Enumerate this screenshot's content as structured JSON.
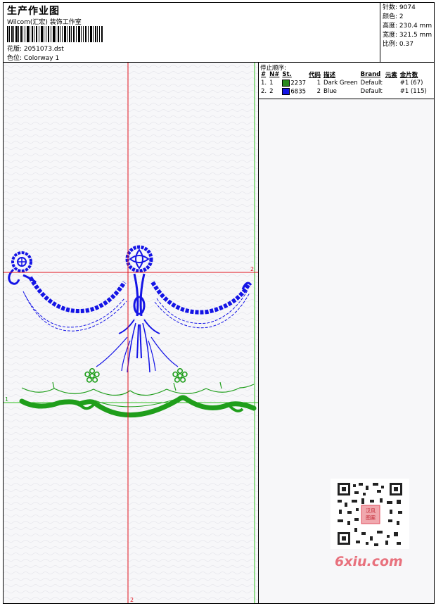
{
  "header": {
    "title": "生产作业图",
    "company": "Wilcom(汇宏) 装饰工作室",
    "design_label": "花版:",
    "design_value": "2051073.dst",
    "colorway_label": "色位:",
    "colorway_value": "Colorway 1"
  },
  "stats": {
    "stitches_label": "针数:",
    "stitches_value": "9074",
    "colors_label": "颜色:",
    "colors_value": "2",
    "height_label": "高度:",
    "height_value": "230.4 mm",
    "width_label": "宽度:",
    "width_value": "321.5 mm",
    "scale_label": "比例:",
    "scale_value": "0.37"
  },
  "stop_sequence": {
    "title": "停止顺序:",
    "columns": [
      "#",
      "N#",
      "St.",
      "代码",
      "描述",
      "Brand",
      "元素",
      "金片数"
    ],
    "rows": [
      {
        "num": "1.",
        "n": "1",
        "swatch": "#2a8a1e",
        "code": "2237",
        "st": "1",
        "desc": "Dark Green",
        "brand": "Default",
        "elem": "#1 (67)"
      },
      {
        "num": "2.",
        "n": "2",
        "swatch": "#1414e6",
        "code": "6835",
        "st": "2",
        "desc": "Blue",
        "brand": "Default",
        "elem": "#1 (115)"
      }
    ]
  },
  "canvas": {
    "marker_1": "1",
    "marker_2_right": "2",
    "marker_2_bottom": "2",
    "colors": {
      "crosshair": "#e0121c",
      "guide": "#2fc21f",
      "green_thread": "#1f9e1b",
      "blue_thread": "#1414e6"
    }
  },
  "watermark": {
    "brand": "6xiu.com",
    "qr_seal_text": "汉风图案"
  }
}
